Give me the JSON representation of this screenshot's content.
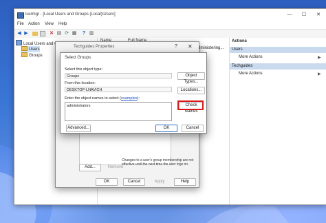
{
  "main_window": {
    "title": "lusrmgr - [Local Users and Groups (Local)\\Users]",
    "menu": [
      "File",
      "Action",
      "View",
      "Help"
    ]
  },
  "tree": {
    "root": "Local Users and Groups (Local)",
    "items": [
      "Users",
      "Groups"
    ]
  },
  "list": {
    "columns": [
      "Name",
      "Full Name"
    ],
    "background_fragments": [
      "Administering..."
    ]
  },
  "actions": {
    "title": "Actions",
    "sections": [
      {
        "header": "Users",
        "link": "More Actions"
      },
      {
        "header": "Techguides",
        "link": "More Actions"
      }
    ]
  },
  "properties_dialog": {
    "title": "Techguides Properties",
    "help_glyph": "?",
    "add_label": "Add...",
    "remove_label": "Remove",
    "note": "Changes to a user's group membership are not effective until the next time the user logs on.",
    "ok_label": "OK",
    "cancel_label": "Cancel",
    "apply_label": "Apply",
    "help_label": "Help"
  },
  "select_groups": {
    "title": "Select Groups",
    "object_type_label": "Select this object type:",
    "object_type_value": "Groups",
    "object_types_button": "Object Types...",
    "location_label": "From this location:",
    "location_value": "DESKTOP-LNAVICH",
    "locations_button": "Locations...",
    "names_label_prefix": "Enter the object names to select (",
    "names_label_link": "examples",
    "names_label_suffix": "):",
    "names_value": "administrators",
    "check_names_button": "Check Names",
    "advanced_button": "Advanced...",
    "ok_button": "OK",
    "cancel_button": "Cancel"
  },
  "colors": {
    "highlight": "#d61a1a",
    "link": "#1a55c9",
    "actions_header": "#c9d9ee"
  }
}
